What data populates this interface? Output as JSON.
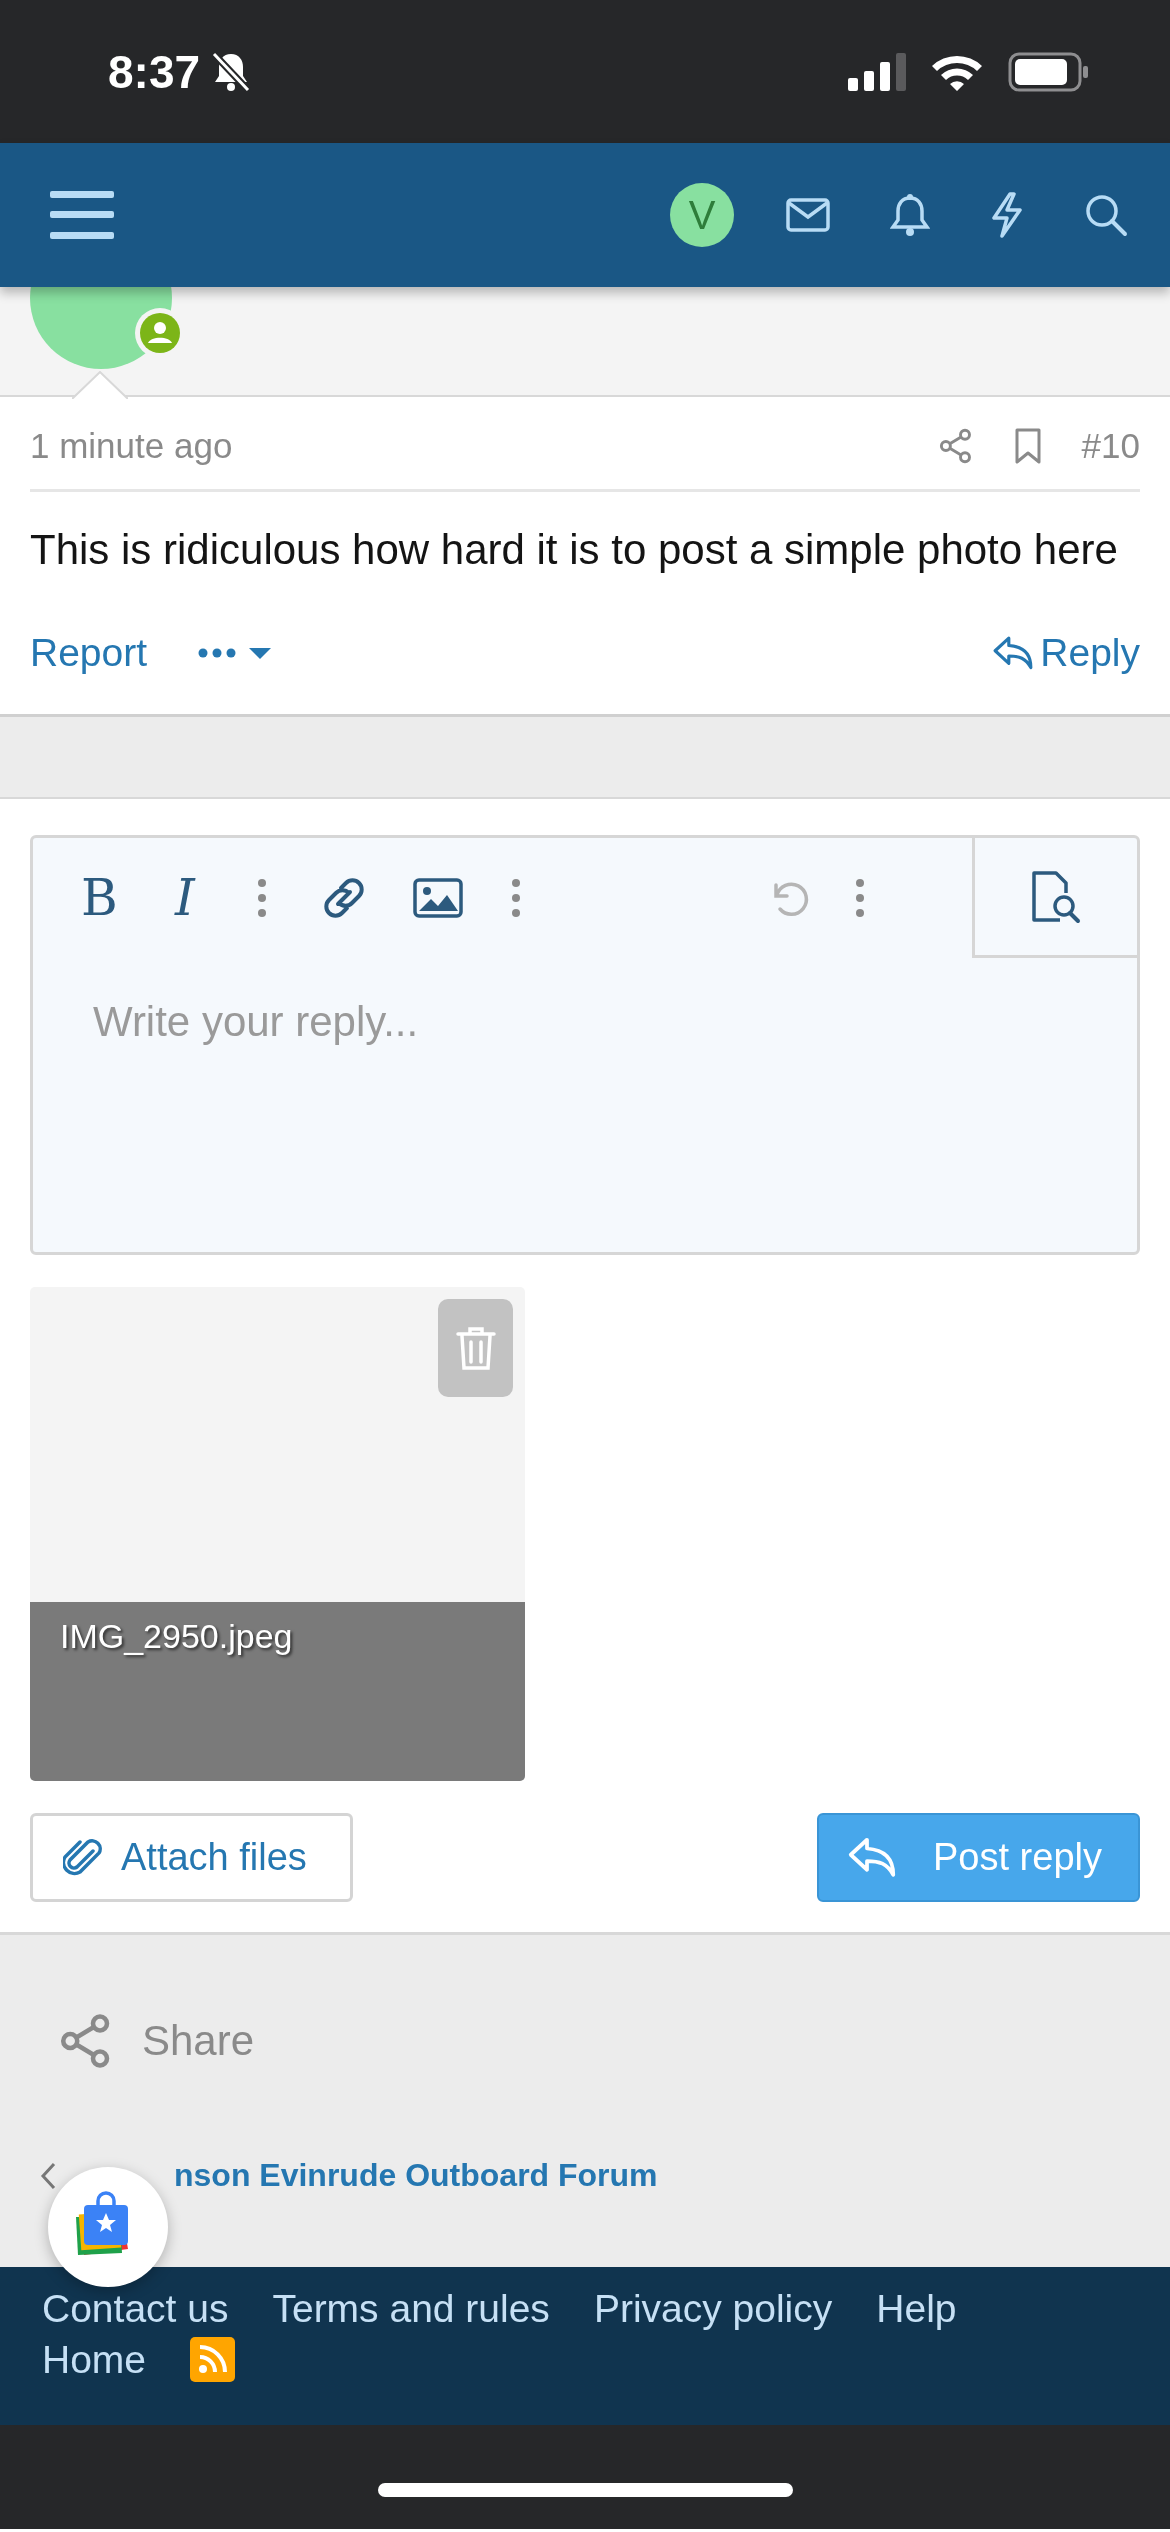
{
  "status_bar": {
    "time": "8:37"
  },
  "nav": {
    "avatar_letter": "V"
  },
  "post": {
    "time": "1 minute ago",
    "number": "#10",
    "message": "This is ridiculous how hard it is to post a simple photo here",
    "report": "Report",
    "reply": "Reply"
  },
  "editor": {
    "placeholder": "Write your reply...",
    "toolbar": [
      {
        "kind": "bold",
        "label": "B",
        "disabled": false
      },
      {
        "kind": "italic",
        "label": "I",
        "disabled": false
      },
      {
        "kind": "more",
        "disabled": false
      },
      {
        "kind": "link",
        "disabled": false
      },
      {
        "kind": "image",
        "disabled": false
      },
      {
        "kind": "more",
        "disabled": false
      },
      {
        "kind": "undo",
        "disabled": true
      },
      {
        "kind": "more",
        "disabled": false
      }
    ]
  },
  "attachments": [
    {
      "filename": "IMG_2950.jpeg"
    }
  ],
  "buttons": {
    "attach": "Attach files",
    "post": "Post reply"
  },
  "share": "Share",
  "breadcrumb": "nson Evinrude Outboard Forum",
  "footer": {
    "links": [
      "Contact us",
      "Terms and rules",
      "Privacy policy",
      "Help",
      "Home"
    ]
  }
}
